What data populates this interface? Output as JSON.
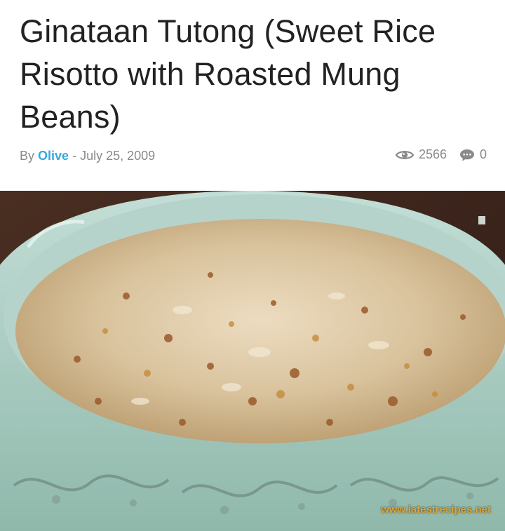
{
  "article": {
    "title": "Ginataan Tutong (Sweet Rice Risotto with Roasted Mung Beans)",
    "byline_prefix": "By",
    "author": "Olive",
    "separator": "-",
    "date": "July 25, 2009",
    "views": "2566",
    "comments": "0"
  },
  "image": {
    "watermark": "www.latestrecipes.net"
  },
  "icons": {
    "views": "eye-icon",
    "comments": "speech-bubble-icon"
  },
  "colors": {
    "author_link": "#36a9e1",
    "meta_text": "#8a8a8a",
    "title_text": "#222222",
    "bowl": "#a9cdc2",
    "watermark": "#d8a63c"
  }
}
